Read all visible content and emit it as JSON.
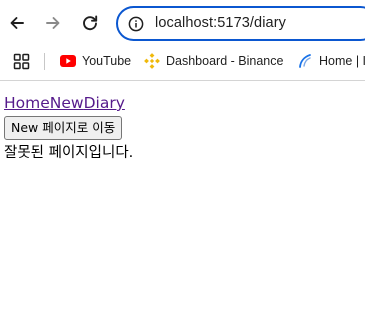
{
  "browser": {
    "url": "localhost:5173/diary",
    "icons": {
      "back": "back-arrow-icon",
      "forward": "forward-arrow-icon",
      "reload": "reload-icon",
      "site_info": "info-icon",
      "apps": "apps-grid-icon"
    },
    "accent_color": "#0b57d0",
    "bookmarks": [
      {
        "label": "YouTube",
        "icon": "youtube-icon"
      },
      {
        "label": "Dashboard - Binance",
        "icon": "binance-icon"
      },
      {
        "label": "Home | I",
        "icon": "home-site-icon"
      }
    ]
  },
  "page": {
    "nav_links": [
      "Home",
      "New",
      "Diary"
    ],
    "new_button_label": "New 페이지로 이동",
    "message": "잘못된 페이지입니다."
  }
}
